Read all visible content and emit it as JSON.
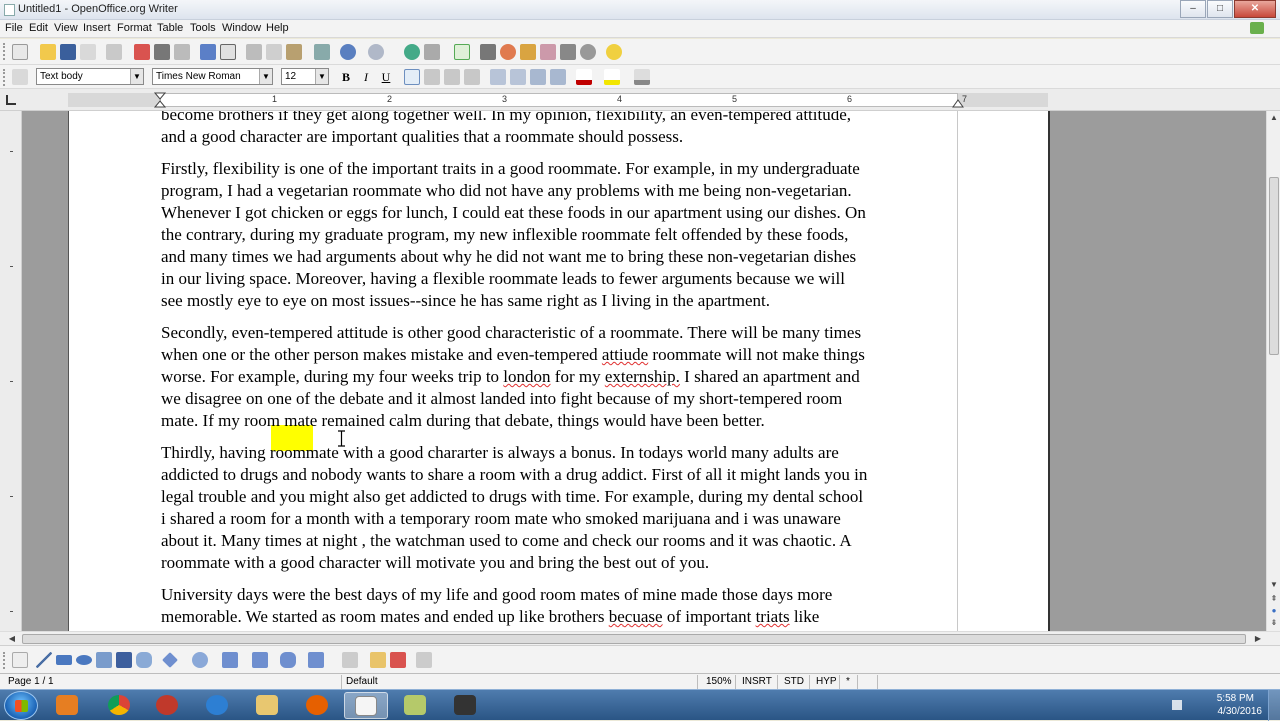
{
  "window": {
    "title": "Untitled1 - OpenOffice.org Writer",
    "min": "–",
    "max": "□",
    "close": "✕"
  },
  "menu": [
    "File",
    "Edit",
    "View",
    "Insert",
    "Format",
    "Table",
    "Tools",
    "Window",
    "Help"
  ],
  "formatting": {
    "style": "Text body",
    "font": "Times New Roman",
    "size": "12",
    "bold": "B",
    "italic": "I",
    "underline": "U"
  },
  "ruler": {
    "labels": [
      "1",
      "2",
      "3",
      "4",
      "5",
      "6",
      "7"
    ]
  },
  "document": {
    "paragraphs": [
      {
        "lines": [
          "become brothers if they get along together well. In my opinion, flexibility, an even-tempered attitude,",
          "and a good character are important qualities that a roommate should possess."
        ]
      },
      {
        "lines": [
          "Firstly, flexibility is one of the important traits in a good roommate. For example, in my undergraduate",
          "program, I had a vegetarian roommate who did not have any problems with me being non-vegetarian.",
          "Whenever I got chicken or eggs for lunch, I could eat these foods in our apartment using our dishes. On",
          "the contrary, during my graduate program, my new inflexible roommate felt offended by these foods,",
          "and many times we had arguments about why he did not want me to bring these non-vegetarian dishes",
          "in our living space. Moreover, having a flexible roommate leads to fewer arguments because we will",
          "see mostly eye to eye on most issues--since he has same right as I living in the apartment."
        ]
      },
      {
        "lines": [
          "Secondly, even-tempered attitude is other good characteristic of a roommate. There will be many times",
          "when one or the other person makes mistake and even-tempered attiude roommate will not make things",
          "worse. For example, during my four weeks trip to london for my externship. I shared an apartment and",
          "we disagree on one of the debate and it almost landed into fight because of my short-tempered room",
          "mate. If my room mate remained calm during that debate, things would have been better."
        ]
      },
      {
        "lines": [
          "Thirdly, having roommate with a good chararter is always a bonus. In todays world many adults are",
          "addicted to drugs and nobody wants to share a room with a drug addict. First of all it might lands you in",
          "legal trouble and you might also get addicted to drugs with time. For example, during my dental school",
          "i shared a room for a month with a temporary room mate who smoked marijuana and i was unaware",
          "about it. Many times at night , the watchman used to come and check our rooms and it was chaotic. A",
          "roommate with a good character will motivate you and bring the best out of you."
        ]
      },
      {
        "lines": [
          "University days were the best days of my life and good room mates of mine made those days more",
          "memorable. We started as room mates and ended up like brothers becuase of important triats like"
        ]
      }
    ],
    "misspelled": [
      "attiude",
      "london",
      "externship.",
      "becuase",
      "triats"
    ]
  },
  "status": {
    "page": "Page 1 / 1",
    "page_style": "Default",
    "zoom": "150%",
    "insert_mode": "INSRT",
    "selection_mode": "STD",
    "hyperlink_mode": "HYP",
    "modified": "*"
  },
  "taskbar": {
    "time": "5:58 PM",
    "date": "4/30/2016"
  }
}
